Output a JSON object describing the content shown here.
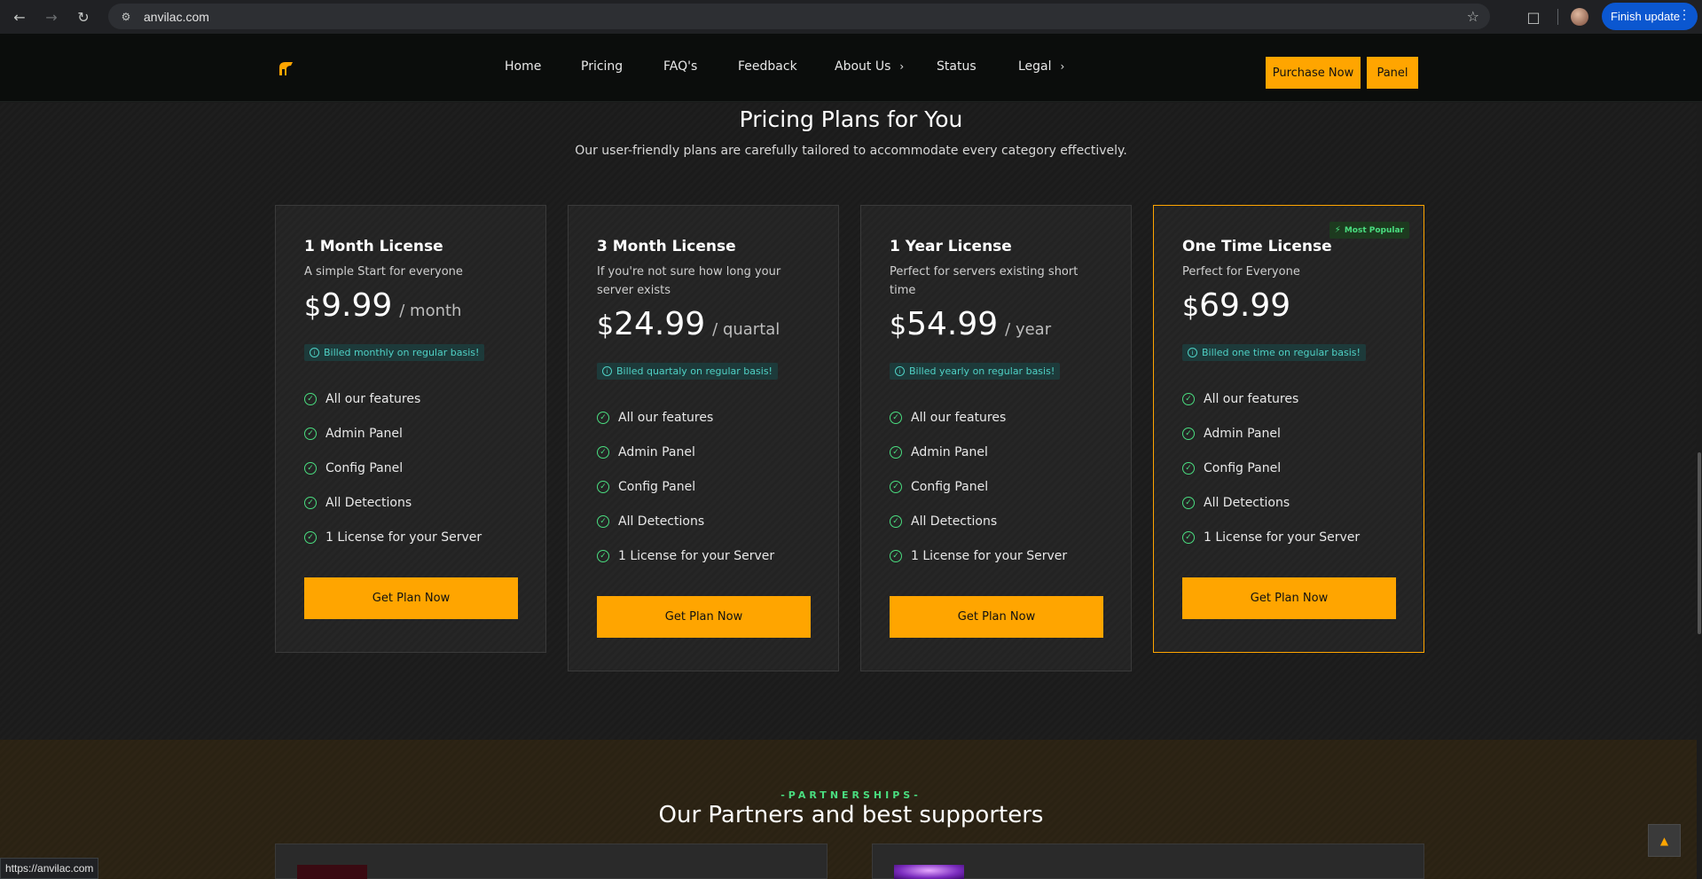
{
  "browser": {
    "url": "anvilac.com",
    "finish_update": "Finish update",
    "status_url": "https://anvilac.com"
  },
  "nav": {
    "items": [
      {
        "label": "Home"
      },
      {
        "label": "Pricing"
      },
      {
        "label": "FAQ's"
      },
      {
        "label": "Feedback"
      },
      {
        "label": "About Us"
      },
      {
        "label": "Status"
      },
      {
        "label": "Legal"
      }
    ],
    "purchase": "Purchase Now",
    "panel": "Panel"
  },
  "pricing": {
    "title": "Pricing Plans for You",
    "subtitle": "Our user-friendly plans are carefully tailored to accommodate every category effectively.",
    "plans": [
      {
        "title": "1 Month License",
        "desc": "A simple Start for everyone",
        "currency": "$",
        "price": "9.99",
        "period": "/ month",
        "billed": "Billed monthly on regular basis!",
        "features": [
          "All our features",
          "Admin Panel",
          "Config Panel",
          "All Detections",
          "1 License for your Server"
        ],
        "button": "Get Plan Now"
      },
      {
        "title": "3 Month License",
        "desc": "If you're not sure how long your server exists",
        "currency": "$",
        "price": "24.99",
        "period": "/ quartal",
        "billed": "Billed quartaly on regular basis!",
        "features": [
          "All our features",
          "Admin Panel",
          "Config Panel",
          "All Detections",
          "1 License for your Server"
        ],
        "button": "Get Plan Now"
      },
      {
        "title": "1 Year License",
        "desc": "Perfect for servers existing short time",
        "currency": "$",
        "price": "54.99",
        "period": "/ year",
        "billed": "Billed yearly on regular basis!",
        "features": [
          "All our features",
          "Admin Panel",
          "Config Panel",
          "All Detections",
          "1 License for your Server"
        ],
        "button": "Get Plan Now"
      },
      {
        "title": "One Time License",
        "desc": "Perfect for Everyone",
        "currency": "$",
        "price": "69.99",
        "period": "",
        "billed": "Billed one time on regular basis!",
        "features": [
          "All our features",
          "Admin Panel",
          "Config Panel",
          "All Detections",
          "1 License for your Server"
        ],
        "button": "Get Plan Now",
        "badge": "Most Popular"
      }
    ]
  },
  "partners": {
    "kicker": "-PARTNERSHIPS-",
    "title": "Our Partners and best supporters"
  },
  "colors": {
    "accent": "#ffa500",
    "check": "#4ade80",
    "billed": "#4fd1c5"
  }
}
